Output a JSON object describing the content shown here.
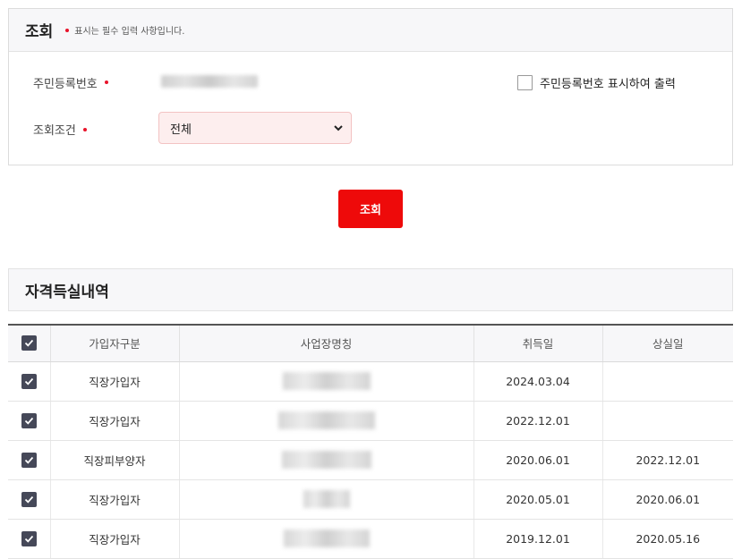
{
  "search": {
    "title": "조회",
    "required_note": "표시는 필수 입력 사항입니다.",
    "rrn_label": "주민등록번호",
    "show_rrn_label": "주민등록번호 표시하여 출력",
    "condition_label": "조회조건",
    "condition_value": "전체",
    "button_label": "조회"
  },
  "history": {
    "title": "자격득실내역",
    "columns": [
      "가입자구분",
      "사업장명칭",
      "취득일",
      "상실일"
    ],
    "rows": [
      {
        "type": "직장가입자",
        "acquired": "2024.03.04",
        "lost": ""
      },
      {
        "type": "직장가입자",
        "acquired": "2022.12.01",
        "lost": ""
      },
      {
        "type": "직장피부양자",
        "acquired": "2020.06.01",
        "lost": "2022.12.01"
      },
      {
        "type": "직장가입자",
        "acquired": "2020.05.01",
        "lost": "2020.06.01"
      },
      {
        "type": "직장가입자",
        "acquired": "2019.12.01",
        "lost": "2020.05.16"
      }
    ]
  },
  "colors": {
    "accent": "#ee0a0a",
    "checkbox": "#454858",
    "required": "#e8132a"
  },
  "icons": [
    "check-icon",
    "chevron-down-icon",
    "required-dot-icon"
  ]
}
